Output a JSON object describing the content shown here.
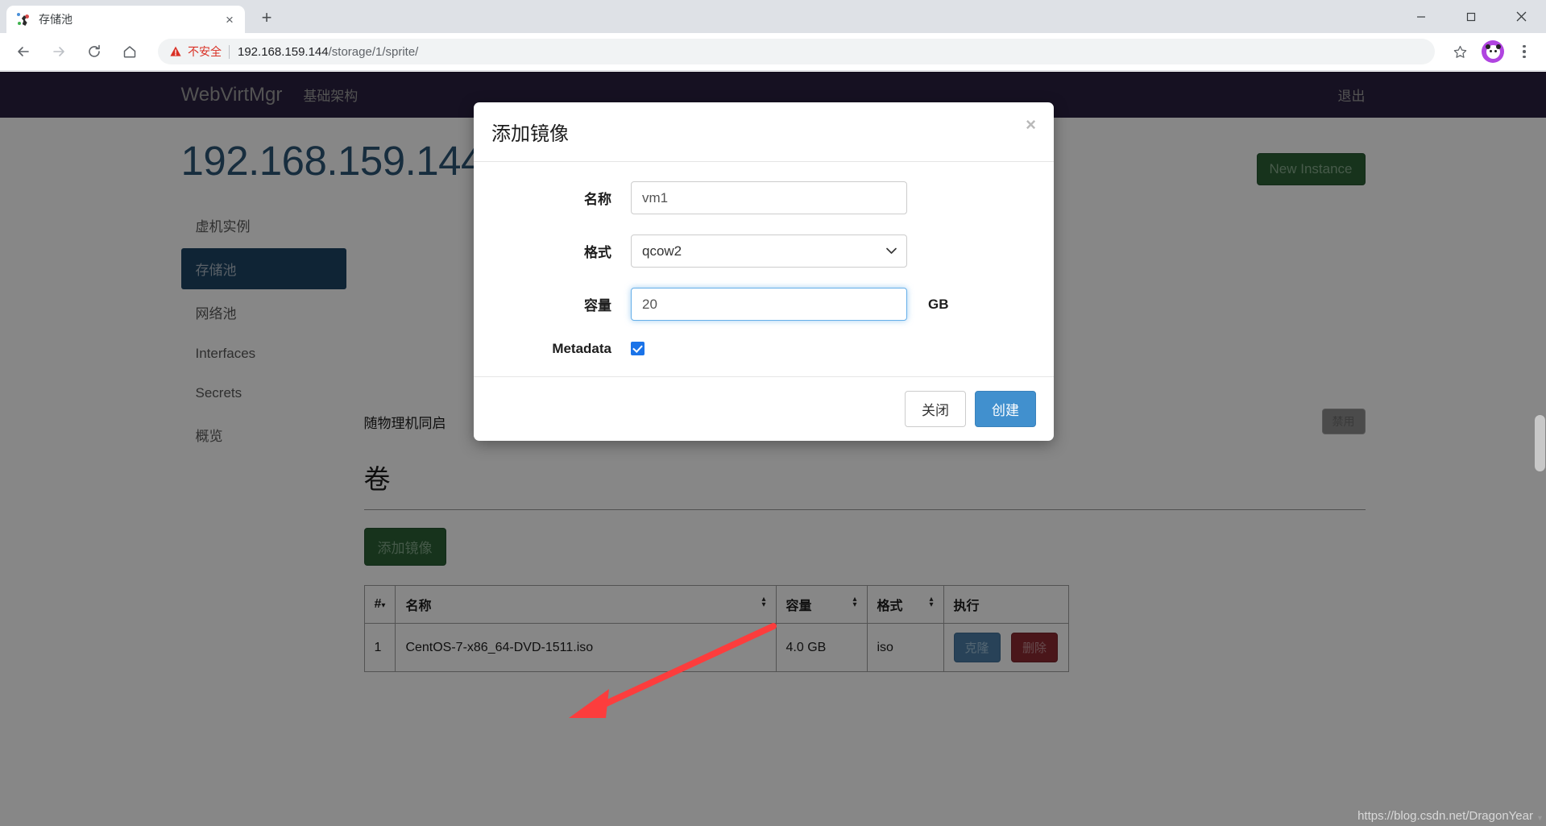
{
  "browser": {
    "tab": {
      "title": "存储池",
      "favicon": "sprite-icon",
      "close": "×"
    },
    "new_tab": "+",
    "nav": {
      "back": "←",
      "forward": "→",
      "reload": "⟳",
      "home": "⌂"
    },
    "omnibox": {
      "security_label": "不安全",
      "url_host": "192.168.159.144",
      "url_path": "/storage/1/sprite/",
      "full_url": "192.168.159.144/storage/1/sprite/"
    },
    "window": {
      "minimize": "—",
      "maximize": "▢",
      "close": "✕"
    },
    "status_url": "https://blog.csdn.net/DragonYear"
  },
  "navbar": {
    "brand": "WebVirtMgr",
    "links": [
      "基础架构"
    ],
    "logout": "退出"
  },
  "page": {
    "title": "192.168.159.144",
    "new_instance": "New Instance"
  },
  "sidebar": {
    "items": [
      {
        "label": "虚机实例",
        "active": false
      },
      {
        "label": "存储池",
        "active": true
      },
      {
        "label": "网络池",
        "active": false
      },
      {
        "label": "Interfaces",
        "active": false
      },
      {
        "label": "Secrets",
        "active": false
      },
      {
        "label": "概览",
        "active": false
      }
    ]
  },
  "main": {
    "hidden_row_label": "随物理机同启",
    "hidden_row_button": "禁用",
    "volumes_title": "卷",
    "add_image_button": "添加镜像",
    "table": {
      "headers": [
        "#",
        "名称",
        "容量",
        "格式",
        "执行"
      ],
      "rows": [
        {
          "num": "1",
          "name": "CentOS-7-x86_64-DVD-1511.iso",
          "capacity": "4.0 GB",
          "format": "iso",
          "clone": "克隆",
          "delete": "删除"
        }
      ]
    }
  },
  "modal": {
    "title": "添加镜像",
    "close_icon": "×",
    "fields": {
      "name_label": "名称",
      "name_value": "vm1",
      "format_label": "格式",
      "format_value": "qcow2",
      "format_options": [
        "qcow2"
      ],
      "capacity_label": "容量",
      "capacity_value": "20",
      "capacity_unit": "GB",
      "metadata_label": "Metadata",
      "metadata_checked": true
    },
    "close_button": "关闭",
    "create_button": "创建"
  },
  "colors": {
    "navbar_bg": "#2b2040",
    "sidebar_active": "#1e4565",
    "page_title": "#2c5575",
    "primary_button": "#4190ce",
    "success_button": "#2c6136",
    "danger_button": "#8c2b32",
    "clone_button": "#4c7da6",
    "arrow_annotation": "#fc3d3d",
    "not_secure": "#d93025",
    "checkbox": "#1a73e8"
  }
}
